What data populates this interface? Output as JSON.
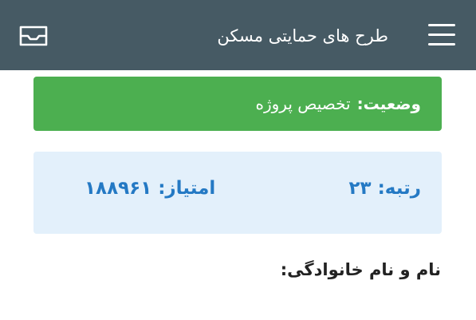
{
  "header": {
    "title": "طرح های حمایتی مسکن",
    "menu_icon": "hamburger-menu-icon",
    "inbox_icon": "inbox-tray-icon",
    "background_color": "#465a64"
  },
  "status": {
    "label": "وضعیت:",
    "value": "تخصیص پروژه",
    "color": "#4caf50"
  },
  "score": {
    "rank_label": "رتبه:",
    "rank_value": "۲۳",
    "points_label": "امتیاز:",
    "points_value": "۱۸۸۹۶۱",
    "background_color": "#e3f0fb",
    "text_color": "#2479c4"
  },
  "profile": {
    "name_label": "نام و نام خانوادگی:"
  }
}
